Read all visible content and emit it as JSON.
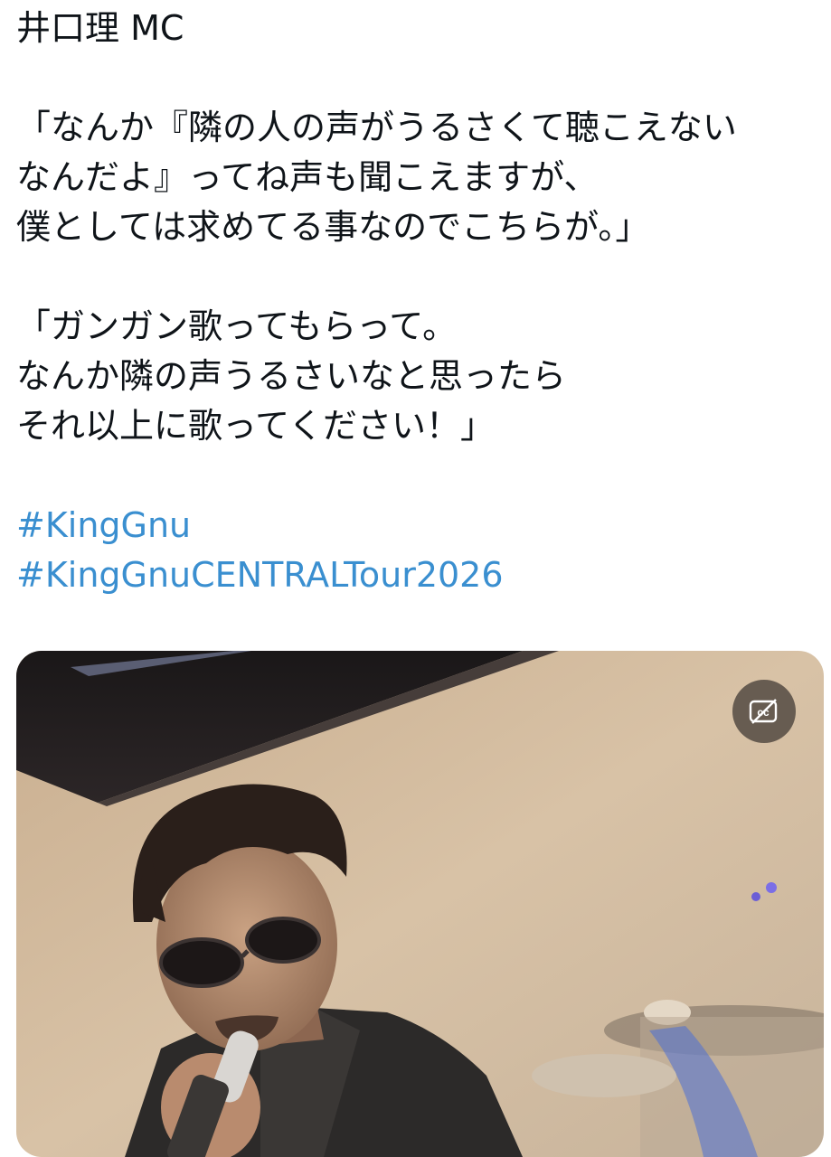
{
  "tweet": {
    "lines": [
      "井口理 MC",
      "",
      "「なんか『隣の人の声がうるさくて聴こえない",
      "なんだよ』ってね声も聞こえますが、",
      "僕としては求めてる事なのでこちらが。」",
      "",
      "「ガンガン歌ってもらって。",
      "なんか隣の声うるさいなと思ったら",
      "それ以上に歌ってください！」",
      ""
    ],
    "hashtags": [
      "#KingGnu",
      "#KingGnuCENTRALTour2026"
    ]
  },
  "media": {
    "type": "video",
    "captions_icon": "captions-off-icon"
  },
  "colors": {
    "text": "#0f1419",
    "link": "#3a8fd0",
    "background": "#ffffff"
  }
}
